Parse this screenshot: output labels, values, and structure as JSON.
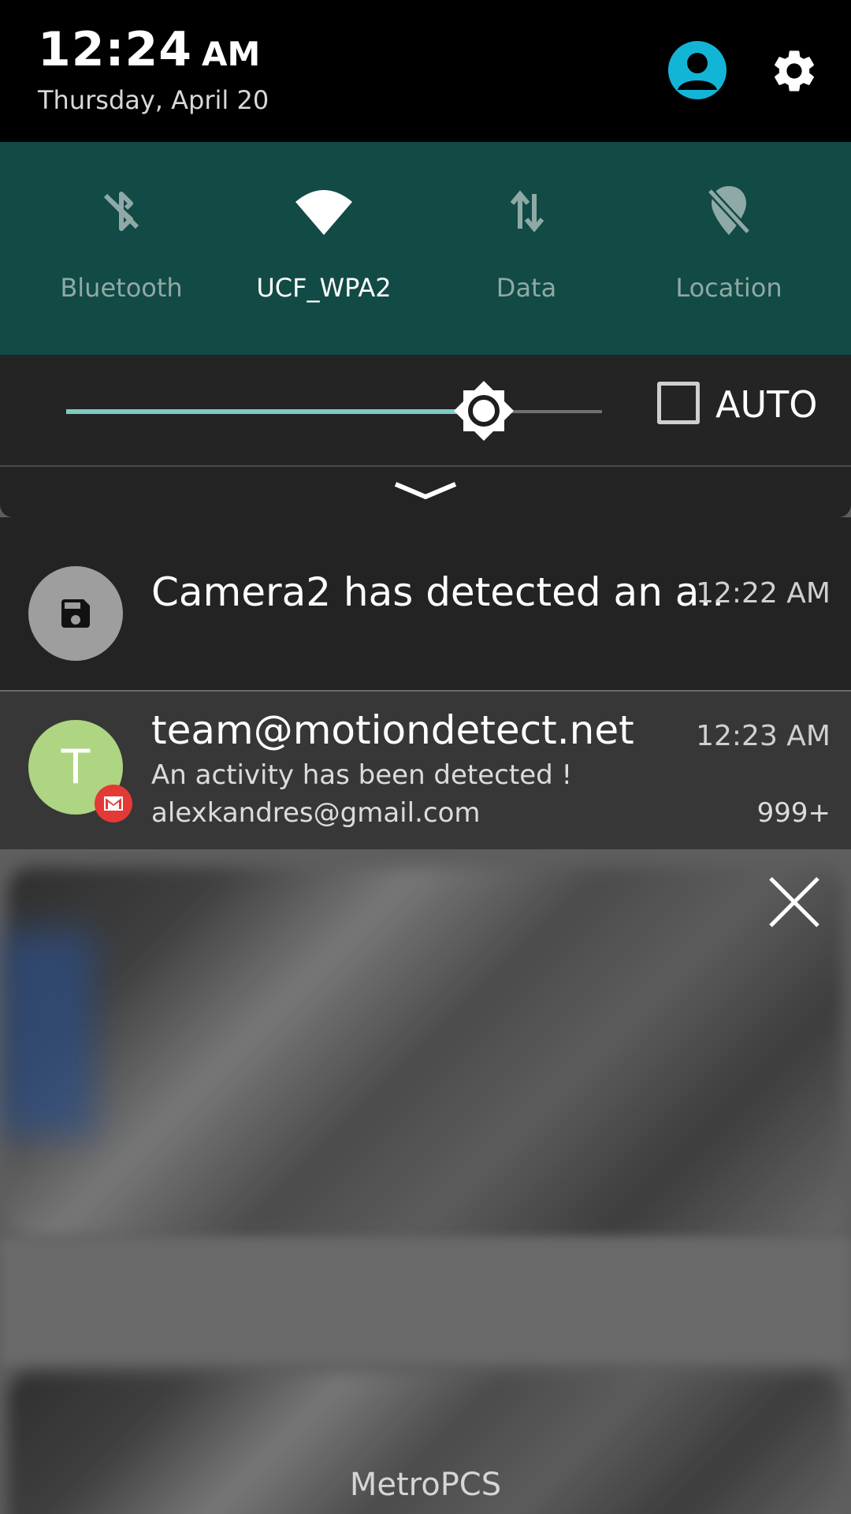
{
  "header": {
    "time": "12:24",
    "ampm": "AM",
    "date": "Thursday, April 20"
  },
  "quick_settings": [
    {
      "label": "Bluetooth",
      "icon": "bluetooth-off-icon",
      "active": false
    },
    {
      "label": "UCF_WPA2",
      "icon": "wifi-icon",
      "active": true
    },
    {
      "label": "Data",
      "icon": "data-arrows-icon",
      "active": false
    },
    {
      "label": "Location",
      "icon": "location-off-icon",
      "active": false
    }
  ],
  "brightness": {
    "level": 0.78,
    "auto_label": "AUTO",
    "auto_checked": false
  },
  "notifications": [
    {
      "icon": "save-icon",
      "title": "Camera2 has detected an a..",
      "time": "12:22 AM"
    },
    {
      "avatar_letter": "T",
      "app_icon": "gmail-icon",
      "title": "team@motiondetect.net",
      "time": "12:23 AM",
      "text": "An activity has been detected !",
      "account": "alexkandres@gmail.com",
      "count": "999+"
    }
  ],
  "carrier": "MetroPCS",
  "colors": {
    "accent": "#13b5d6",
    "quick_settings_bg": "#124a45",
    "slider_fill": "#7fcbc3",
    "avatar_bg": "#aed581",
    "gmail_badge": "#e53935"
  }
}
